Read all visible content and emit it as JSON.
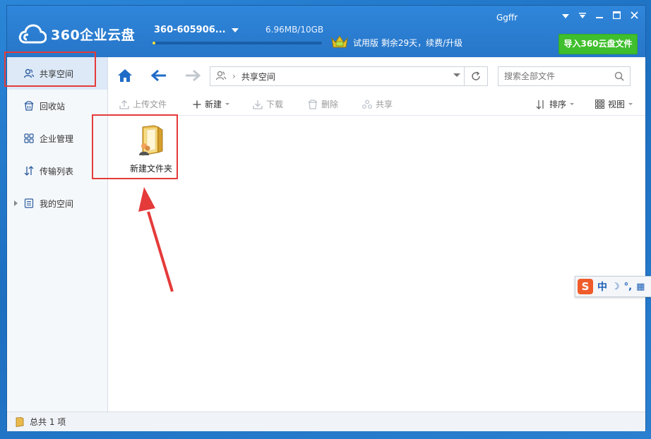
{
  "app": {
    "logo_text": "360企业云盘",
    "account_id": "360-605906...",
    "storage_usage": "6.96MB/10GB",
    "storage_fraction": 0.001,
    "trial_text": "试用版 剩余29天，续费/升级",
    "username": "Ggffr",
    "import_button": "导入360云盘文件"
  },
  "sidebar": {
    "items": [
      {
        "label": "共享空间",
        "icon": "user-group-icon"
      },
      {
        "label": "回收站",
        "icon": "recycle-bin-icon"
      },
      {
        "label": "企业管理",
        "icon": "grid-icon"
      },
      {
        "label": "传输列表",
        "icon": "transfer-icon"
      },
      {
        "label": "我的空间",
        "icon": "document-icon"
      }
    ]
  },
  "navbar": {
    "path_label": "共享空间",
    "search_placeholder": "搜索全部文件"
  },
  "toolbar": {
    "upload": "上传文件",
    "new": "新建",
    "download": "下载",
    "delete": "删除",
    "share": "共享",
    "sort": "排序",
    "view": "视图"
  },
  "files": [
    {
      "name": "新建文件夹",
      "icon": "shared-folder-icon"
    }
  ],
  "status": {
    "count_text": "总共 1 项"
  },
  "ime": {
    "logo": "S",
    "mode": "中",
    "punct": "°,"
  },
  "colors": {
    "titlebar": "#2b7fd4",
    "import_button": "#3fbf2d",
    "highlight": "#e53a3a",
    "active_sidebar": "#dde9f7"
  }
}
